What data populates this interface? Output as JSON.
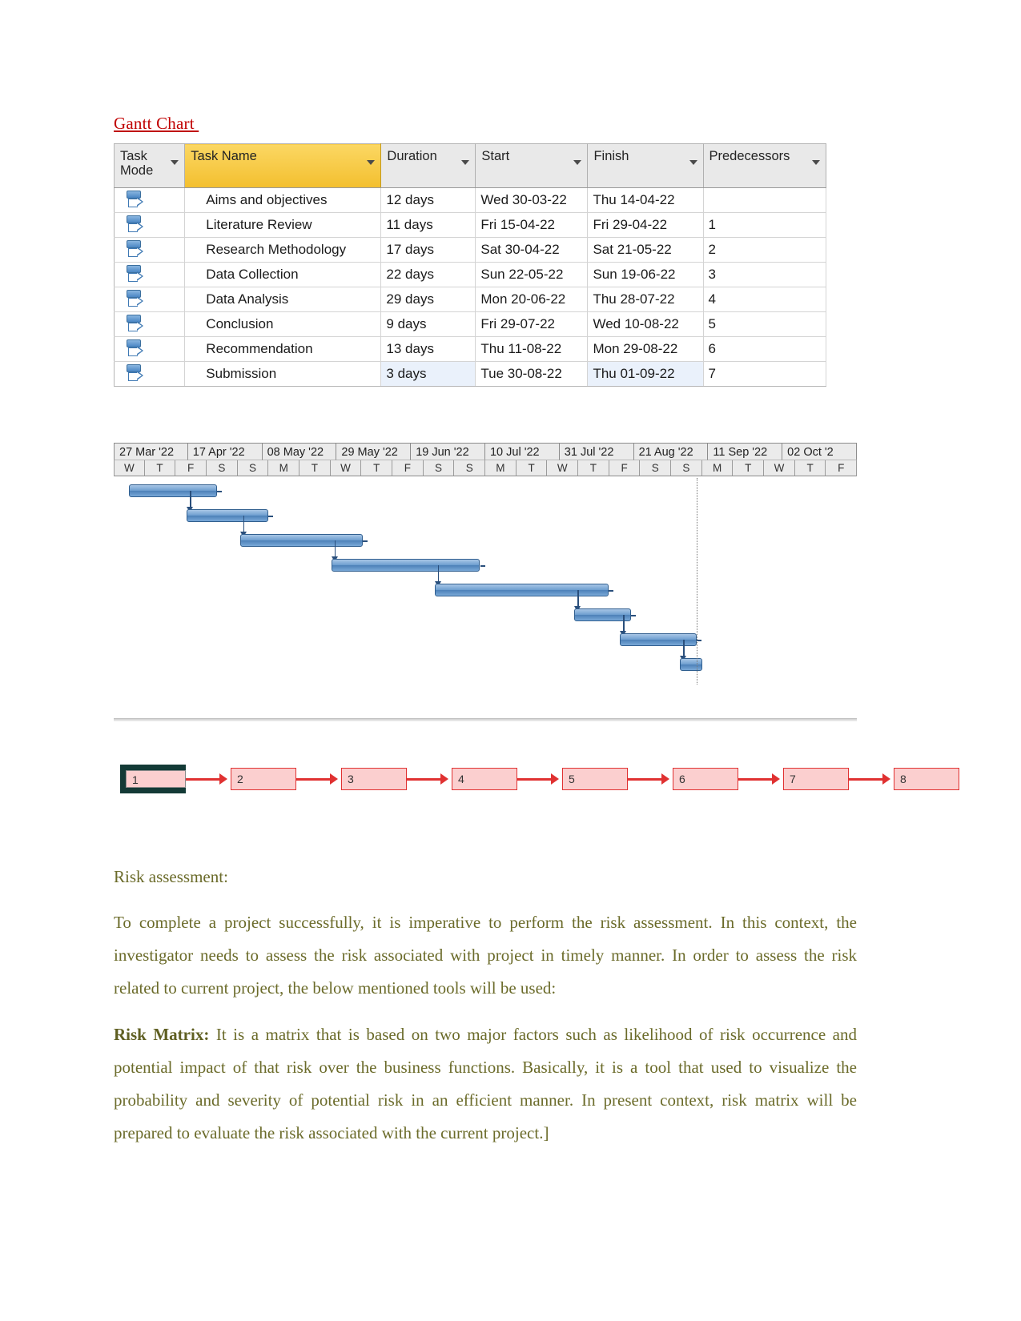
{
  "heading": {
    "title": "Gantt Chart "
  },
  "task_table": {
    "columns": [
      {
        "key": "mode",
        "label": "Task Mode"
      },
      {
        "key": "name",
        "label": "Task Name"
      },
      {
        "key": "dur",
        "label": "Duration"
      },
      {
        "key": "start",
        "label": "Start"
      },
      {
        "key": "fin",
        "label": "Finish"
      },
      {
        "key": "pred",
        "label": "Predecessors"
      }
    ],
    "highlight_color": "#f5c842",
    "rows": [
      {
        "mode_icon": "manually-scheduled-icon",
        "name": "Aims and objectives",
        "dur": "12 days",
        "start": "Wed 30-03-22",
        "fin": "Thu 14-04-22",
        "pred": ""
      },
      {
        "mode_icon": "manually-scheduled-icon",
        "name": "Literature Review",
        "dur": "11 days",
        "start": "Fri 15-04-22",
        "fin": "Fri 29-04-22",
        "pred": "1"
      },
      {
        "mode_icon": "manually-scheduled-icon",
        "name": "Research Methodology",
        "dur": "17 days",
        "start": "Sat 30-04-22",
        "fin": "Sat 21-05-22",
        "pred": "2"
      },
      {
        "mode_icon": "manually-scheduled-icon",
        "name": "Data Collection",
        "dur": "22 days",
        "start": "Sun 22-05-22",
        "fin": "Sun 19-06-22",
        "pred": "3"
      },
      {
        "mode_icon": "manually-scheduled-icon",
        "name": "Data Analysis",
        "dur": "29 days",
        "start": "Mon 20-06-22",
        "fin": "Thu 28-07-22",
        "pred": "4"
      },
      {
        "mode_icon": "manually-scheduled-icon",
        "name": "Conclusion",
        "dur": "9 days",
        "start": "Fri 29-07-22",
        "fin": "Wed 10-08-22",
        "pred": "5"
      },
      {
        "mode_icon": "manually-scheduled-icon",
        "name": "Recommendation",
        "dur": "13 days",
        "start": "Thu 11-08-22",
        "fin": "Mon 29-08-22",
        "pred": "6"
      },
      {
        "mode_icon": "manually-scheduled-icon",
        "name": "Submission",
        "dur": "3 days",
        "start": "Tue 30-08-22",
        "fin": "Thu 01-09-22",
        "pred": "7"
      }
    ]
  },
  "chart_data": {
    "type": "bar",
    "title": "Gantt Chart",
    "xlabel": "",
    "ylabel": "",
    "timescale_top": [
      "27 Mar '22",
      "17 Apr '22",
      "08 May '22",
      "29 May '22",
      "19 Jun '22",
      "10 Jul '22",
      "31 Jul '22",
      "21 Aug '22",
      "11 Sep '22",
      "02 Oct '2"
    ],
    "timescale_bottom": [
      "W",
      "T",
      "F",
      "S",
      "S",
      "M",
      "T",
      "W",
      "T",
      "F",
      "S",
      "S",
      "M",
      "T",
      "W",
      "T",
      "F",
      "S",
      "S",
      "M",
      "T",
      "W",
      "T",
      "F"
    ],
    "categories": [
      "Aims and objectives",
      "Literature Review",
      "Research Methodology",
      "Data Collection",
      "Data Analysis",
      "Conclusion",
      "Recommendation",
      "Submission"
    ],
    "values": [
      12,
      11,
      17,
      22,
      29,
      9,
      13,
      3
    ],
    "bars": [
      {
        "task": "Aims and objectives",
        "start": "2022-03-30",
        "finish": "2022-04-14",
        "duration_days": 12,
        "left_pct": 2.0,
        "width_pct": 11.9
      },
      {
        "task": "Literature Review",
        "start": "2022-04-15",
        "finish": "2022-04-29",
        "duration_days": 11,
        "left_pct": 9.8,
        "width_pct": 11.0
      },
      {
        "task": "Research Methodology",
        "start": "2022-04-30",
        "finish": "2022-05-21",
        "duration_days": 17,
        "left_pct": 17.0,
        "width_pct": 16.5
      },
      {
        "task": "Data Collection",
        "start": "2022-05-22",
        "finish": "2022-06-19",
        "duration_days": 22,
        "left_pct": 29.3,
        "width_pct": 20.0
      },
      {
        "task": "Data Analysis",
        "start": "2022-06-20",
        "finish": "2022-07-28",
        "duration_days": 29,
        "left_pct": 43.2,
        "width_pct": 23.4
      },
      {
        "task": "Conclusion",
        "start": "2022-07-29",
        "finish": "2022-08-10",
        "duration_days": 9,
        "left_pct": 62.0,
        "width_pct": 7.6
      },
      {
        "task": "Recommendation",
        "start": "2022-08-11",
        "finish": "2022-08-29",
        "duration_days": 13,
        "left_pct": 68.1,
        "width_pct": 10.4
      },
      {
        "task": "Submission",
        "start": "2022-08-30",
        "finish": "2022-09-01",
        "duration_days": 3,
        "left_pct": 76.2,
        "width_pct": 3.0
      }
    ],
    "today_line_pct": 78.5,
    "grid": true,
    "legend": "none"
  },
  "network_diagram": {
    "nodes": [
      "1",
      "2",
      "3",
      "4",
      "5",
      "6",
      "7",
      "8"
    ],
    "selected_node": "1",
    "node_fill": "#fbcfcf",
    "node_border": "#e03131",
    "connector_color": "#e03131"
  },
  "body": {
    "risk_heading": "Risk assessment:",
    "paragraph_1": "To complete a project successfully, it is imperative to perform the risk assessment. In this context, the investigator needs to assess the risk associated with project in timely manner. In order to assess the risk related to current project, the below mentioned tools will be used:",
    "paragraph_2_bold": "Risk Matrix:",
    "paragraph_2": " It is a matrix that is based on two major factors such as likelihood of risk occurrence and potential impact of that risk over the business functions. Basically, it is a tool that used to visualize the probability and severity of potential risk in an efficient manner. In present context, risk matrix will be prepared to evaluate the risk associated with the current project.]",
    "text_color": "#6b6b2a"
  }
}
